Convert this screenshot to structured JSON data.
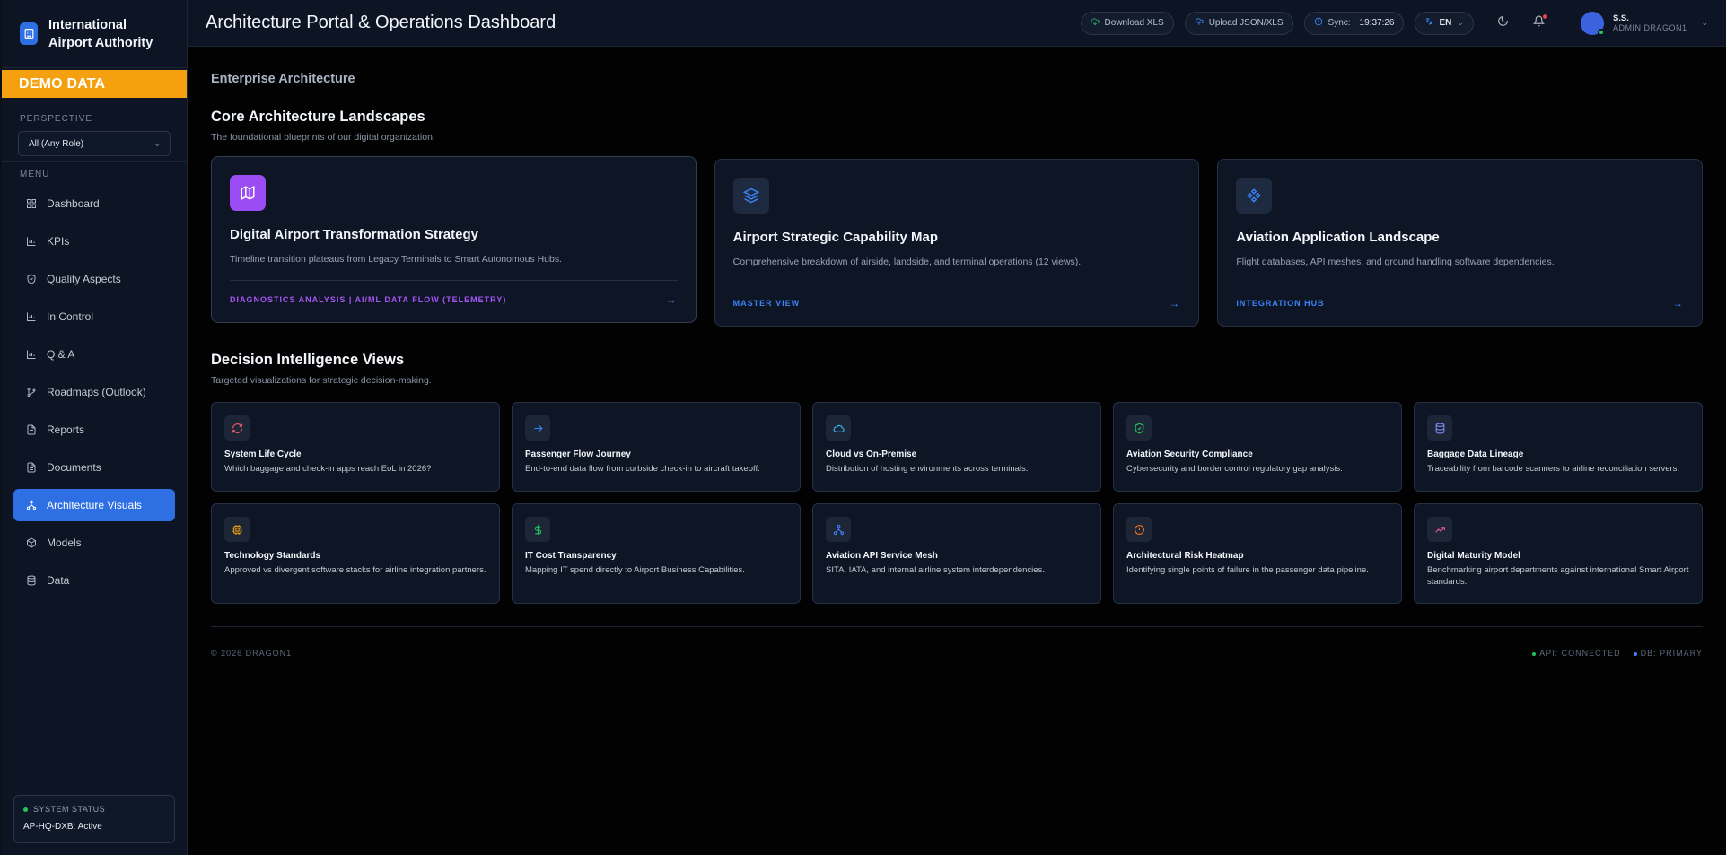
{
  "brand": {
    "name": "International Airport Authority"
  },
  "demo_banner": "DEMO DATA",
  "sidebar": {
    "perspective_label": "PERSPECTIVE",
    "perspective_value": "All (Any Role)",
    "menu_label": "MENU",
    "items": [
      {
        "label": "Dashboard",
        "icon": "grid-icon"
      },
      {
        "label": "KPIs",
        "icon": "bar-chart-icon"
      },
      {
        "label": "Quality Aspects",
        "icon": "shield-check-icon"
      },
      {
        "label": "In Control",
        "icon": "bar-chart-icon"
      },
      {
        "label": "Q & A",
        "icon": "bar-chart-icon"
      },
      {
        "label": "Roadmaps (Outlook)",
        "icon": "git-branch-icon"
      },
      {
        "label": "Reports",
        "icon": "file-text-icon"
      },
      {
        "label": "Documents",
        "icon": "file-text-icon"
      },
      {
        "label": "Architecture Visuals",
        "icon": "network-icon",
        "active": true
      },
      {
        "label": "Models",
        "icon": "box-icon"
      },
      {
        "label": "Data",
        "icon": "database-icon"
      }
    ],
    "status": {
      "label": "SYSTEM STATUS",
      "value": "AP-HQ-DXB: Active"
    }
  },
  "header": {
    "title": "Architecture Portal & Operations Dashboard",
    "download_label": "Download XLS",
    "upload_label": "Upload JSON/XLS",
    "sync_label": "Sync:",
    "sync_time": "19:37:26",
    "language": "EN",
    "user": {
      "initials": "S.S.",
      "role": "ADMIN DRAGON1"
    }
  },
  "breadcrumb": "Enterprise Architecture",
  "landscapes": {
    "title": "Core Architecture Landscapes",
    "subtitle": "The foundational blueprints of our digital organization.",
    "cards": [
      {
        "title": "Digital Airport Transformation Strategy",
        "desc": "Timeline transition plateaus from Legacy Terminals to Smart Autonomous Hubs.",
        "link": "DIAGNOSTICS ANALYSIS | AI/ML DATA FLOW (TELEMETRY)",
        "icon": "map-icon"
      },
      {
        "title": "Airport Strategic Capability Map",
        "desc": "Comprehensive breakdown of airside, landside, and terminal operations (12 views).",
        "link": "MASTER VIEW",
        "icon": "layers-icon"
      },
      {
        "title": "Aviation Application Landscape",
        "desc": "Flight databases, API meshes, and ground handling software dependencies.",
        "link": "INTEGRATION HUB",
        "icon": "components-icon"
      }
    ]
  },
  "views": {
    "title": "Decision Intelligence Views",
    "subtitle": "Targeted visualizations for strategic decision-making.",
    "cards": [
      {
        "title": "System Life Cycle",
        "desc": "Which baggage and check-in apps reach EoL in 2026?",
        "icon": "refresh-icon",
        "color": "#f05a6e"
      },
      {
        "title": "Passenger Flow Journey",
        "desc": "End-to-end data flow from curbside check-in to aircraft takeoff.",
        "icon": "arrow-right-icon",
        "color": "#3b82f6"
      },
      {
        "title": "Cloud vs On-Premise",
        "desc": "Distribution of hosting environments across terminals.",
        "icon": "cloud-icon",
        "color": "#38bdf8"
      },
      {
        "title": "Aviation Security Compliance",
        "desc": "Cybersecurity and border control regulatory gap analysis.",
        "icon": "shield-check-icon",
        "color": "#22c55e"
      },
      {
        "title": "Baggage Data Lineage",
        "desc": "Traceability from barcode scanners to airline reconciliation servers.",
        "icon": "database-icon",
        "color": "#818cf8"
      },
      {
        "title": "Technology Standards",
        "desc": "Approved vs divergent software stacks for airline integration partners.",
        "icon": "cpu-icon",
        "color": "#f5a00f"
      },
      {
        "title": "IT Cost Transparency",
        "desc": "Mapping IT spend directly to Airport Business Capabilities.",
        "icon": "dollar-icon",
        "color": "#22c55e"
      },
      {
        "title": "Aviation API Service Mesh",
        "desc": "SITA, IATA, and internal airline system interdependencies.",
        "icon": "network-icon",
        "color": "#3b82f6"
      },
      {
        "title": "Architectural Risk Heatmap",
        "desc": "Identifying single points of failure in the passenger data pipeline.",
        "icon": "alert-circle-icon",
        "color": "#f97316"
      },
      {
        "title": "Digital Maturity Model",
        "desc": "Benchmarking airport departments against international Smart Airport standards.",
        "icon": "trending-up-icon",
        "color": "#f05a9e"
      }
    ]
  },
  "footer": {
    "copyright": "© 2026 DRAGON1",
    "api_status": "API: CONNECTED",
    "db_status": "DB: PRIMARY"
  },
  "colors": {
    "accent": "#2f6fe4",
    "demo": "#f5a00f",
    "purple": "#a855f7",
    "ok": "#22c55e"
  }
}
